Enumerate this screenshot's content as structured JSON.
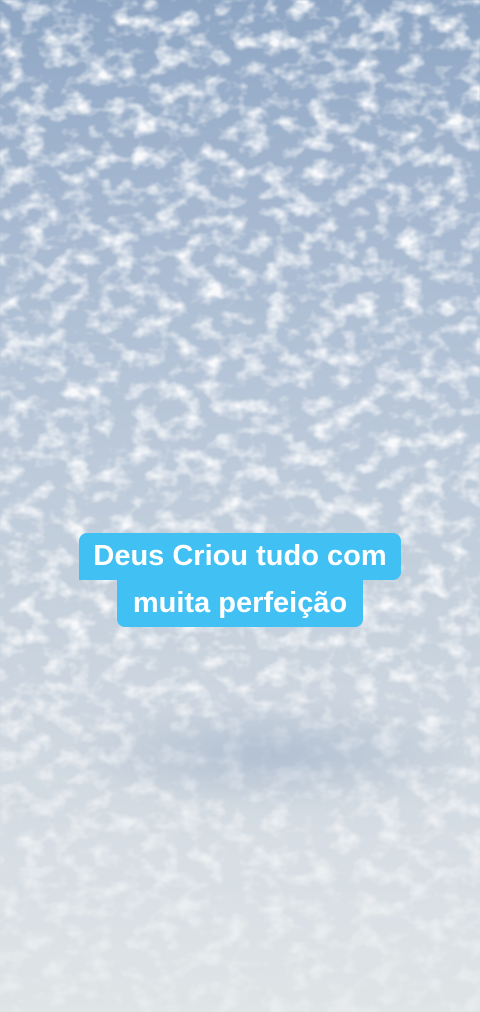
{
  "caption": {
    "line1": "Deus Criou tudo com",
    "line2": "muita perfeição"
  },
  "colors": {
    "caption_background": "#40c0f3",
    "caption_text": "#ffffff",
    "sky_top": "#8ea6c4",
    "sky_bottom": "#dfe4e6"
  }
}
